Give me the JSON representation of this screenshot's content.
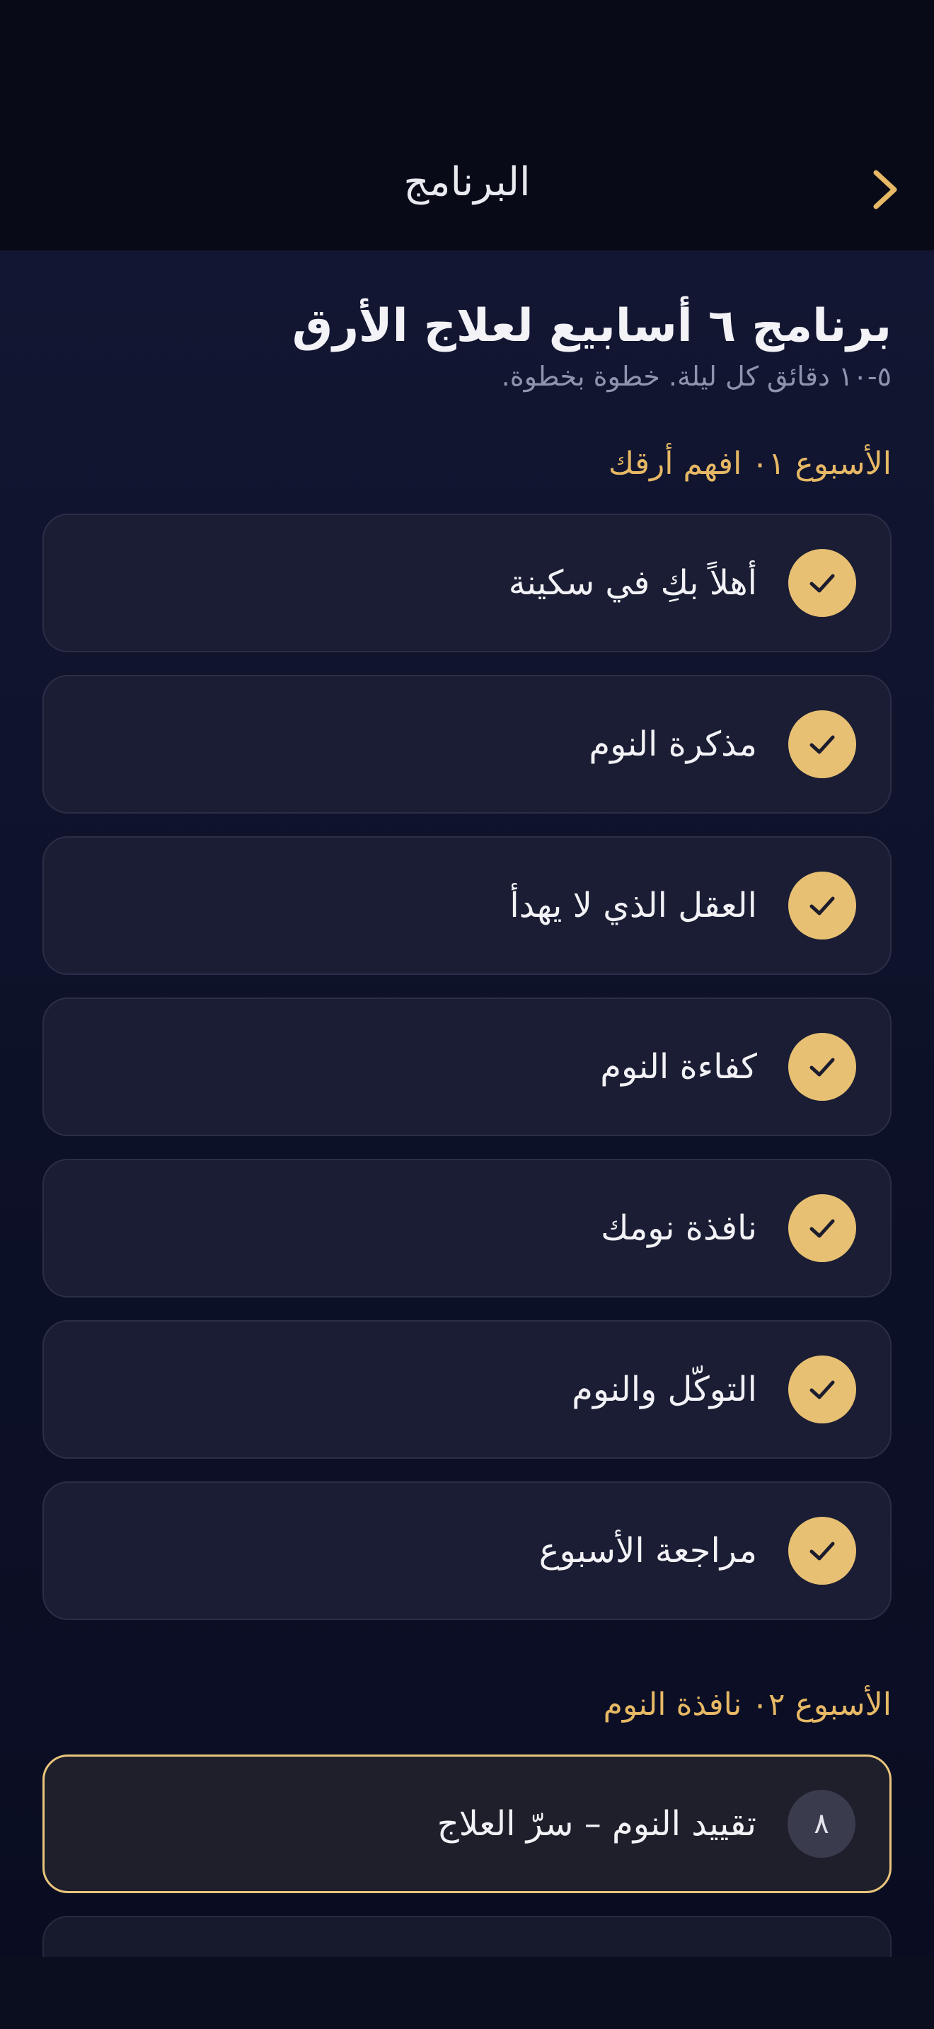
{
  "header": {
    "title": "البرنامج",
    "back_icon": "chevron-icon",
    "accent_color": "#e7b865"
  },
  "program": {
    "title": "برنامج ٦ أسابيع لعلاج الأرق",
    "subtitle": "٥-١٠ دقائق كل ليلة. خطوة بخطوة."
  },
  "weeks": [
    {
      "heading": "الأسبوع ٠١ افهم أرقك",
      "lessons": [
        {
          "title": "أهلاً بكِ في سكينة",
          "status": "completed"
        },
        {
          "title": "مذكرة النوم",
          "status": "completed"
        },
        {
          "title": "العقل الذي لا يهدأ",
          "status": "completed"
        },
        {
          "title": "كفاءة النوم",
          "status": "completed"
        },
        {
          "title": "نافذة نومك",
          "status": "completed"
        },
        {
          "title": "التوكّل والنوم",
          "status": "completed"
        },
        {
          "title": "مراجعة الأسبوع",
          "status": "completed"
        }
      ]
    },
    {
      "heading": "الأسبوع ٠٢ نافذة النوم",
      "lessons": [
        {
          "title": "تقييد النوم – سرّ العلاج",
          "status": "current",
          "number": "٨"
        },
        {
          "title": "",
          "status": "upcoming"
        }
      ]
    }
  ]
}
